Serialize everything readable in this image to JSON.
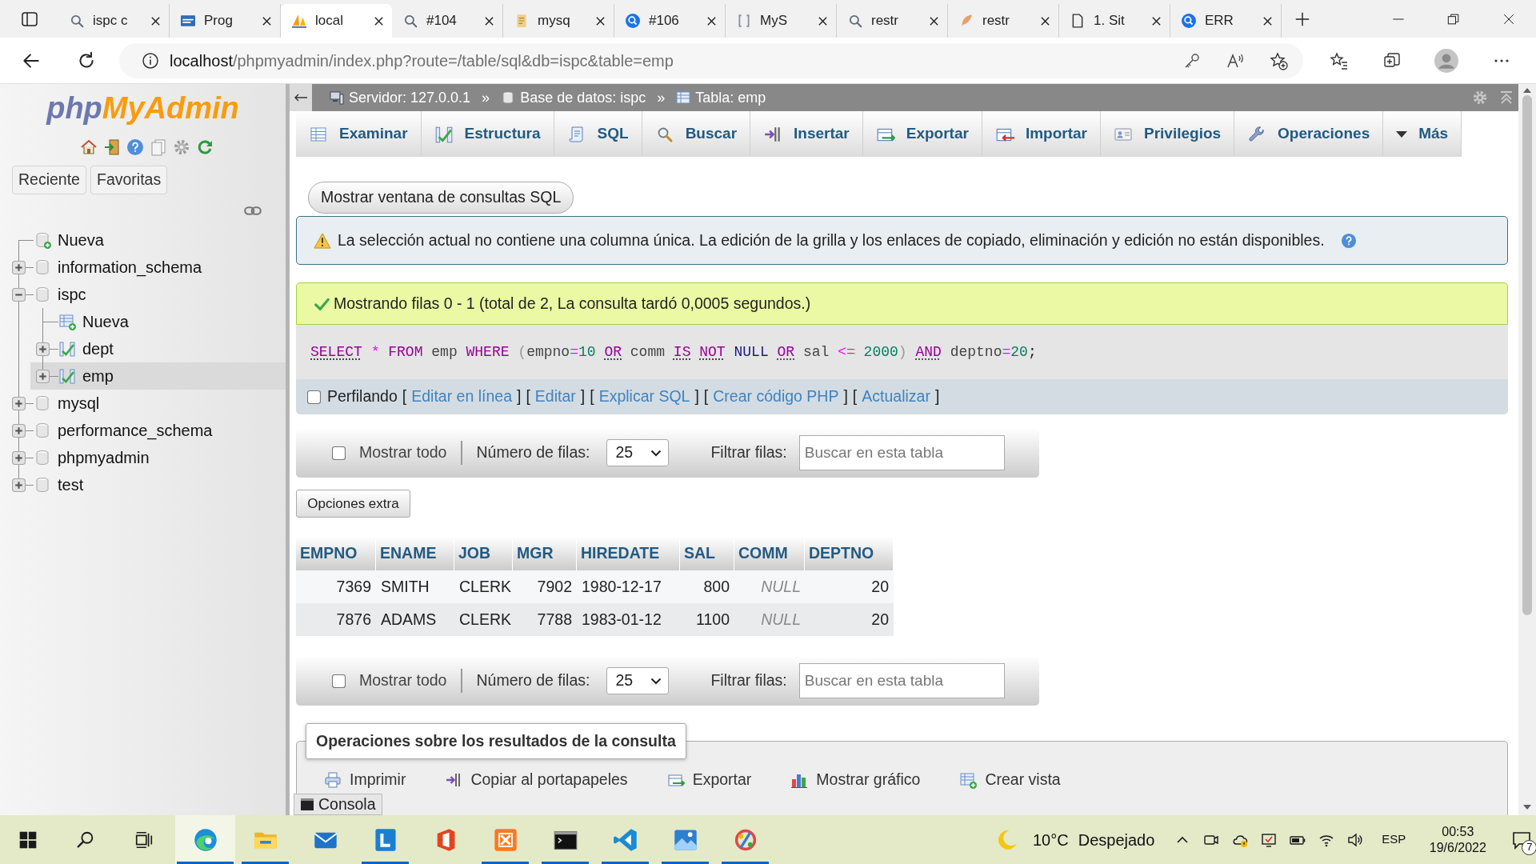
{
  "browser": {
    "tabs": [
      {
        "title": "ispc c",
        "kind": "search",
        "selected": false
      },
      {
        "title": "Prog",
        "kind": "badge",
        "selected": false
      },
      {
        "title": "local",
        "kind": "sail",
        "selected": true
      },
      {
        "title": "#104",
        "kind": "search",
        "selected": false
      },
      {
        "title": "mysq",
        "kind": "stack",
        "selected": false
      },
      {
        "title": "#106",
        "kind": "search_blue",
        "selected": false
      },
      {
        "title": "MyS",
        "kind": "doc",
        "selected": false
      },
      {
        "title": "restr",
        "kind": "search",
        "selected": false
      },
      {
        "title": "restr",
        "kind": "feather",
        "selected": false
      },
      {
        "title": "1. Sit",
        "kind": "page",
        "selected": false
      },
      {
        "title": "ERR",
        "kind": "search_blue",
        "selected": false
      }
    ],
    "address": {
      "host": "localhost",
      "path": "/phpmyadmin/index.php?route=/table/sql&db=ispc&table=emp"
    }
  },
  "sidebar": {
    "logo": {
      "part_1": "php",
      "part_2": "MyAdmin"
    },
    "buttons": [
      "Reciente",
      "Favoritas"
    ],
    "tree": [
      {
        "label": "Nueva",
        "kind": "new",
        "selected": false
      },
      {
        "label": "information_schema",
        "kind": "database",
        "expanded": false,
        "selected": false
      },
      {
        "label": "ispc",
        "kind": "database",
        "expanded": true,
        "selected": false,
        "children": [
          {
            "label": "Nueva",
            "kind": "new_table",
            "selected": false
          },
          {
            "label": "dept",
            "kind": "table",
            "expanded": false,
            "selected": false
          },
          {
            "label": "emp",
            "kind": "table",
            "expanded": false,
            "selected": true
          }
        ]
      },
      {
        "label": "mysql",
        "kind": "database",
        "expanded": false,
        "selected": false
      },
      {
        "label": "performance_schema",
        "kind": "database",
        "expanded": false,
        "selected": false
      },
      {
        "label": "phpmyadmin",
        "kind": "database",
        "expanded": false,
        "selected": false
      },
      {
        "label": "test",
        "kind": "database",
        "expanded": false,
        "selected": false
      }
    ]
  },
  "breadcrumb": [
    {
      "kind": "server",
      "label": "Servidor: 127.0.0.1"
    },
    {
      "kind": "separator",
      "label": "»"
    },
    {
      "kind": "database",
      "label": "Base de datos: ispc"
    },
    {
      "kind": "separator",
      "label": "»"
    },
    {
      "kind": "table",
      "label": "Tabla: emp"
    }
  ],
  "menu": [
    {
      "label": "Examinar",
      "kind": "browse",
      "selected": false
    },
    {
      "label": "Estructura",
      "kind": "structure",
      "selected": false
    },
    {
      "label": "SQL",
      "kind": "sql",
      "selected": false
    },
    {
      "label": "Buscar",
      "kind": "search",
      "selected": false
    },
    {
      "label": "Insertar",
      "kind": "insert",
      "selected": false
    },
    {
      "label": "Exportar",
      "kind": "export",
      "selected": false
    },
    {
      "label": "Importar",
      "kind": "import",
      "selected": false
    },
    {
      "label": "Privilegios",
      "kind": "privileges",
      "selected": false
    },
    {
      "label": "Operaciones",
      "kind": "operations",
      "selected": false
    },
    {
      "label": "Más",
      "kind": "more",
      "selected": false
    }
  ],
  "query_window_button": "Mostrar ventana de consultas SQL",
  "notice": "La selección actual no contiene una columna única. La edición de la grilla y los enlaces de copiado, eliminación y edición no están disponibles.",
  "success": "Mostrando filas 0 - 1 (total de 2, La consulta tardó 0,0005 segundos.)",
  "sql": [
    {
      "text": "SELECT",
      "kind": "keyword_link",
      "space_after": true
    },
    {
      "text": "*",
      "kind": "operator",
      "space_after": true
    },
    {
      "text": "FROM",
      "kind": "keyword",
      "space_after": true
    },
    {
      "text": "emp",
      "kind": "identifier",
      "space_after": true
    },
    {
      "text": "WHERE",
      "kind": "keyword",
      "space_after": true
    },
    {
      "text": "(",
      "kind": "punct",
      "space_after": false
    },
    {
      "text": "empno",
      "kind": "identifier",
      "space_after": false
    },
    {
      "text": "=",
      "kind": "operator",
      "space_after": false
    },
    {
      "text": "10",
      "kind": "number",
      "space_after": true
    },
    {
      "text": "OR",
      "kind": "keyword_link",
      "space_after": true
    },
    {
      "text": "comm",
      "kind": "identifier",
      "space_after": true
    },
    {
      "text": "IS",
      "kind": "keyword_link",
      "space_after": true
    },
    {
      "text": "NOT",
      "kind": "keyword_link",
      "space_after": true
    },
    {
      "text": "NULL",
      "kind": "null",
      "space_after": true
    },
    {
      "text": "OR",
      "kind": "keyword_link",
      "space_after": true
    },
    {
      "text": "sal",
      "kind": "identifier",
      "space_after": true
    },
    {
      "text": "<=",
      "kind": "operator",
      "space_after": true
    },
    {
      "text": "2000",
      "kind": "number",
      "space_after": false
    },
    {
      "text": ")",
      "kind": "punct",
      "space_after": true
    },
    {
      "text": "AND",
      "kind": "keyword_link",
      "space_after": true
    },
    {
      "text": "deptno",
      "kind": "identifier",
      "space_after": false
    },
    {
      "text": "=",
      "kind": "operator",
      "space_after": false
    },
    {
      "text": "20",
      "kind": "number",
      "space_after": false
    },
    {
      "text": ";",
      "kind": "end",
      "space_after": false
    }
  ],
  "profiling": {
    "checked": false,
    "label": "Perfilando",
    "links": [
      {
        "open": "[",
        "label": "Editar en línea",
        "close": "]"
      },
      {
        "open": "[",
        "label": "Editar",
        "close": "]"
      },
      {
        "open": "[",
        "label": "Explicar SQL",
        "close": "]"
      },
      {
        "open": "[",
        "label": "Crear código PHP",
        "close": "]"
      },
      {
        "open": "[",
        "label": "Actualizar",
        "close": "]"
      }
    ]
  },
  "navigation_top": {
    "show_all": {
      "label": "Mostrar todo",
      "checked": false
    },
    "rows_label": "Número de filas:",
    "rows_value": "25",
    "filter_label": "Filtrar filas:",
    "placeholder": "Buscar en esta tabla"
  },
  "extra_options_button": "Opciones extra",
  "table": {
    "columns": [
      {
        "label": "EMPNO",
        "kind": "number"
      },
      {
        "label": "ENAME",
        "kind": "text"
      },
      {
        "label": "JOB",
        "kind": "text"
      },
      {
        "label": "MGR",
        "kind": "number"
      },
      {
        "label": "HIREDATE",
        "kind": "text"
      },
      {
        "label": "SAL",
        "kind": "number"
      },
      {
        "label": "COMM",
        "kind": "number"
      },
      {
        "label": "DEPTNO",
        "kind": "number"
      }
    ],
    "rows": [
      {
        "cells": [
          {
            "text": "7369",
            "kind": "value"
          },
          {
            "text": "SMITH",
            "kind": "value"
          },
          {
            "text": "CLERK",
            "kind": "value"
          },
          {
            "text": "7902",
            "kind": "value"
          },
          {
            "text": "1980-12-17",
            "kind": "value"
          },
          {
            "text": "800",
            "kind": "value"
          },
          {
            "text": "NULL",
            "kind": "null"
          },
          {
            "text": "20",
            "kind": "value"
          }
        ]
      },
      {
        "cells": [
          {
            "text": "7876",
            "kind": "value"
          },
          {
            "text": "ADAMS",
            "kind": "value"
          },
          {
            "text": "CLERK",
            "kind": "value"
          },
          {
            "text": "7788",
            "kind": "value"
          },
          {
            "text": "1983-01-12",
            "kind": "value"
          },
          {
            "text": "1100",
            "kind": "value"
          },
          {
            "text": "NULL",
            "kind": "null"
          },
          {
            "text": "20",
            "kind": "value"
          }
        ]
      }
    ]
  },
  "navigation_bottom": {
    "show_all": {
      "label": "Mostrar todo",
      "checked": false
    },
    "rows_label": "Número de filas:",
    "rows_value": "25",
    "filter_label": "Filtrar filas:",
    "placeholder": "Buscar en esta tabla"
  },
  "operations": {
    "title": "Operaciones sobre los resultados de la consulta",
    "actions": [
      {
        "label": "Imprimir",
        "kind": "print"
      },
      {
        "label": "Copiar al portapapeles",
        "kind": "copy"
      },
      {
        "label": "Exportar",
        "kind": "export"
      },
      {
        "label": "Mostrar gráfico",
        "kind": "chart"
      },
      {
        "label": "Crear vista",
        "kind": "view"
      }
    ]
  },
  "console": "Consola",
  "taskbar": {
    "apps": [
      {
        "kind": "edge",
        "running": true,
        "active": true
      },
      {
        "kind": "explorer",
        "running": true,
        "active": false
      },
      {
        "kind": "mail",
        "running": false,
        "active": false
      },
      {
        "kind": "tile",
        "running": true,
        "active": false
      },
      {
        "kind": "office",
        "running": false,
        "active": false
      },
      {
        "kind": "xampp",
        "running": true,
        "active": false
      },
      {
        "kind": "terminal",
        "running": true,
        "active": false
      },
      {
        "kind": "editor",
        "running": true,
        "active": false
      },
      {
        "kind": "photos",
        "running": true,
        "active": false
      },
      {
        "kind": "paint",
        "running": true,
        "active": false
      }
    ],
    "weather": {
      "temperature": "10°C",
      "condition": "Despejado"
    },
    "language": "ESP",
    "time": "00:53",
    "date": "19/6/2022",
    "notifications": "7"
  }
}
